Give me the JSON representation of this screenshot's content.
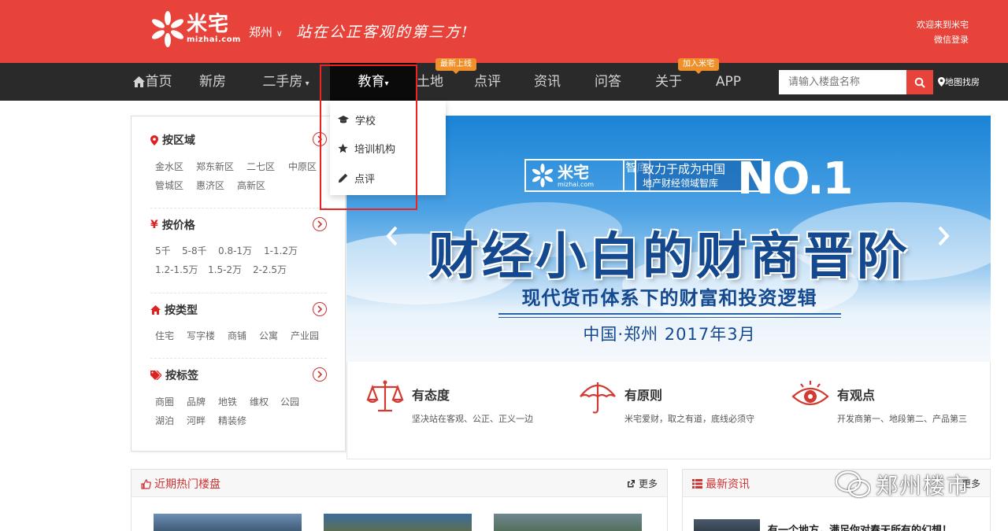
{
  "header": {
    "logo_cn": "米宅",
    "logo_en": "mizhai.com",
    "city": "郑州",
    "slogan": "站在公正客观的第三方!",
    "welcome": "欢迎来到米宅",
    "wechat_login": "微信登录",
    "brand_color": "#e8433a"
  },
  "nav": {
    "items": [
      {
        "label": "首页"
      },
      {
        "label": "新房"
      },
      {
        "label": "二手房"
      },
      {
        "label": "教育"
      },
      {
        "label": "土地",
        "badge": "最新上线"
      },
      {
        "label": "点评"
      },
      {
        "label": "资讯"
      },
      {
        "label": "问答"
      },
      {
        "label": "关于",
        "badge": "加入米宅"
      },
      {
        "label": "APP"
      }
    ],
    "search_placeholder": "请输入楼盘名称",
    "map_find": "地图找房"
  },
  "dropdown": {
    "items": [
      {
        "label": "学校",
        "icon": "graduation-cap-icon"
      },
      {
        "label": "培训机构",
        "icon": "star-icon"
      },
      {
        "label": "点评",
        "icon": "pencil-icon"
      }
    ]
  },
  "filters": {
    "region": {
      "title": "按区域",
      "tags": [
        "金水区",
        "郑东新区",
        "二七区",
        "中原区",
        "管城区",
        "惠济区",
        "高新区"
      ]
    },
    "price": {
      "title": "按价格",
      "tags": [
        "5千",
        "5-8千",
        "0.8-1万",
        "1-1.2万",
        "1.2-1.5万",
        "1.5-2万",
        "2-2.5万"
      ]
    },
    "type": {
      "title": "按类型",
      "tags": [
        "住宅",
        "写字楼",
        "商铺",
        "公寓",
        "产业园"
      ]
    },
    "tag": {
      "title": "按标签",
      "tags": [
        "商圈",
        "品牌",
        "地铁",
        "维权",
        "公园",
        "湖泊",
        "河畔",
        "精装修"
      ]
    }
  },
  "banner": {
    "logo_cn": "米宅",
    "logo_en": "mizhai.com",
    "zhiku": "智库",
    "mission_line1": "致力于成为中国",
    "mission_line2": "地产财经领域智库",
    "no1": "NO.1",
    "title": "财经小白的财商晋阶",
    "subtitle": "现代货币体系下的财富和投资逻辑",
    "place_date": "中国·郑州 2017年3月"
  },
  "values": [
    {
      "title": "有态度",
      "desc": "坚决站在客观、公正、正义一边",
      "icon": "scales-icon"
    },
    {
      "title": "有原则",
      "desc": "米宅爱财，取之有道，底线必须守",
      "icon": "umbrella-icon"
    },
    {
      "title": "有观点",
      "desc": "开发商第一、地段第二、产品第三",
      "icon": "eye-icon"
    }
  ],
  "hot": {
    "title": "近期热门楼盘",
    "more": "更多"
  },
  "news": {
    "title": "最新资讯",
    "more": "更多",
    "first_item": "有一个地方，满足你对春天所有的幻想！"
  },
  "watermark": "郑州楼市"
}
